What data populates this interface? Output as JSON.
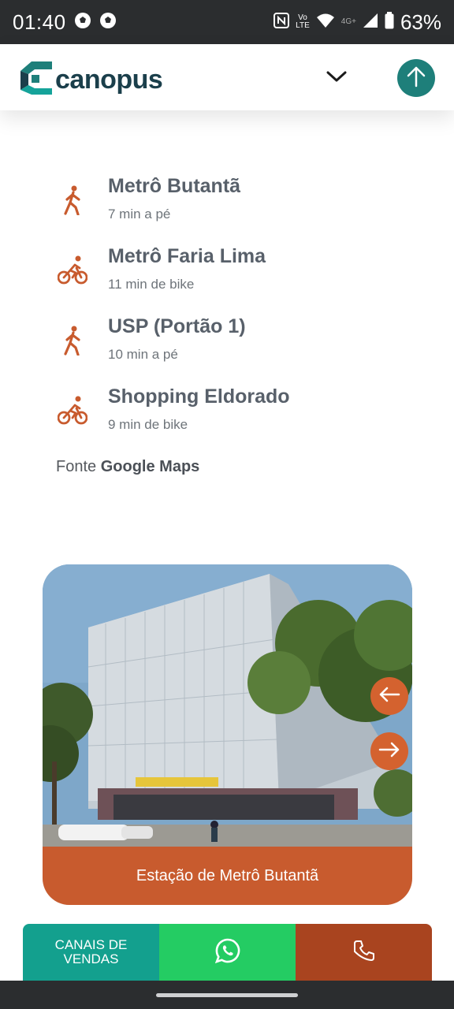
{
  "status_bar": {
    "time": "01:40",
    "battery": "63%",
    "network": "4G+",
    "volte_top": "Vo",
    "volte_bottom": "LTE",
    "icons": [
      "soccer-ball-icon",
      "soccer-ball-icon",
      "nfc-icon",
      "volte-icon",
      "wifi-icon",
      "signal-icon",
      "battery-icon"
    ]
  },
  "header": {
    "logo_text": "canopus",
    "icons": [
      "canopus-logo-mark",
      "chevron-down-icon",
      "arrow-up-icon"
    ]
  },
  "places": [
    {
      "name": "Metrô Butantã",
      "time": "7 min a pé",
      "mode": "walk-icon"
    },
    {
      "name": "Metrô Faria Lima",
      "time": "11 min de bike",
      "mode": "bike-icon"
    },
    {
      "name": "USP (Portão 1)",
      "time": "10 min a pé",
      "mode": "walk-icon"
    },
    {
      "name": "Shopping Eldorado",
      "time": "9 min de bike",
      "mode": "bike-icon"
    }
  ],
  "source": {
    "prefix": "Fonte",
    "name": "Google Maps"
  },
  "gallery": {
    "caption": "Estação de Metrô Butantã",
    "icons": [
      "arrow-left-icon",
      "arrow-right-icon"
    ]
  },
  "actions": {
    "sales_line1": "CANAIS DE",
    "sales_line2": "VENDAS",
    "icons": [
      "whatsapp-icon",
      "phone-icon"
    ]
  },
  "colors": {
    "accent_orange": "#d4622f",
    "caption_orange": "#c85b2e",
    "teal": "#1e7f7a",
    "sales_teal": "#13a08e",
    "whatsapp_green": "#24cc63",
    "phone_brown": "#a9441f"
  }
}
